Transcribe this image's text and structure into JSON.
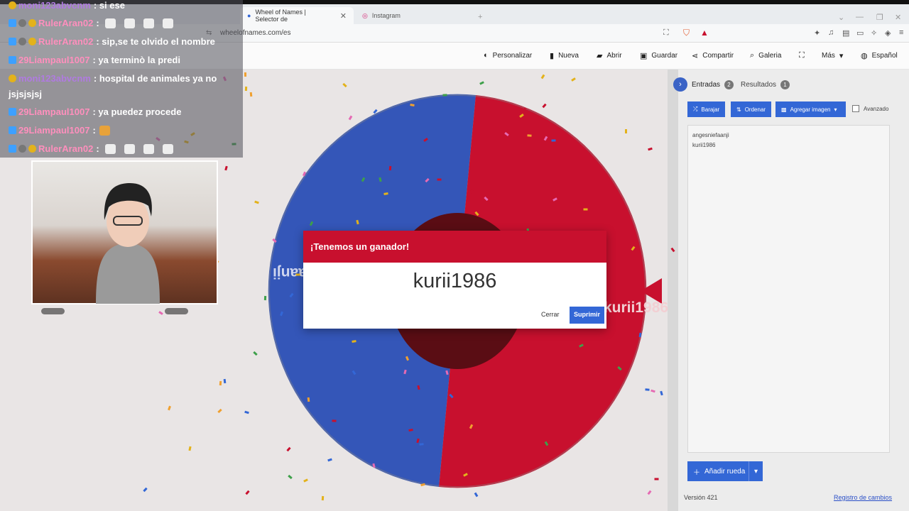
{
  "browser": {
    "tabs": [
      {
        "label": "Wheel of Names | Selector de",
        "active": true
      },
      {
        "label": "Instagram",
        "active": false
      }
    ],
    "url": "wheelofnames.com/es",
    "colors": {
      "accent": "#3367d6",
      "brand_red": "#c8102e"
    }
  },
  "nav": {
    "items": [
      {
        "label": "Personalizar",
        "icon": "palette-icon"
      },
      {
        "label": "Nueva",
        "icon": "new-file-icon"
      },
      {
        "label": "Abrir",
        "icon": "folder-icon"
      },
      {
        "label": "Guardar",
        "icon": "save-icon"
      },
      {
        "label": "Compartir",
        "icon": "share-icon"
      },
      {
        "label": "Galeria",
        "icon": "search-icon"
      },
      {
        "label": "Más",
        "icon": "chevron-down-icon"
      },
      {
        "label": "Español",
        "icon": "globe-icon"
      }
    ]
  },
  "wheel": {
    "segments": [
      {
        "label": "angesniefaanji",
        "color": "#3456b8"
      },
      {
        "label": "kurii1986",
        "color": "#c8102e"
      }
    ]
  },
  "dialog": {
    "title": "¡Tenemos un ganador!",
    "winner": "kurii1986",
    "cancel_label": "Cerrar",
    "confirm_label": "Suprimir"
  },
  "panel": {
    "tab_entries": "Entradas",
    "entries_count": "2",
    "tab_results": "Resultados",
    "results_count": "1",
    "shuffle_label": "Barajar",
    "sort_label": "Ordenar",
    "add_image_label": "Agregar imagen",
    "advanced_label": "Avanzado",
    "entries": [
      "angesniefaanji",
      "kurii1986"
    ],
    "add_wheel_label": "Añadir rueda",
    "version": "Versión 421",
    "changelog": "Registro de cambios"
  },
  "chat": {
    "lines": [
      {
        "user": "moni123abvcnm",
        "msg": ": si ese",
        "color": "#b07ae0"
      },
      {
        "user": "RulerAran02",
        "msg": ":",
        "color": "#ff8fbd"
      },
      {
        "user": "RulerAran02",
        "msg": ": sip,se te olvido el nombre",
        "color": "#ff8fbd"
      },
      {
        "user": "29Liampaul1007",
        "msg": ": ya terminò la predi",
        "color": "#ff8fbd"
      },
      {
        "user": "moni123abvcnm",
        "msg": ": hospital de animales ya no",
        "color": "#b07ae0"
      },
      {
        "user": "",
        "msg": "jsjsjsjsj",
        "color": "#ffffff"
      },
      {
        "user": "29Liampaul1007",
        "msg": ": ya puedez procede",
        "color": "#ff8fbd"
      },
      {
        "user": "29Liampaul1007",
        "msg": ":",
        "color": "#ff8fbd"
      },
      {
        "user": "RulerAran02",
        "msg": ":",
        "color": "#ff8fbd"
      }
    ]
  }
}
